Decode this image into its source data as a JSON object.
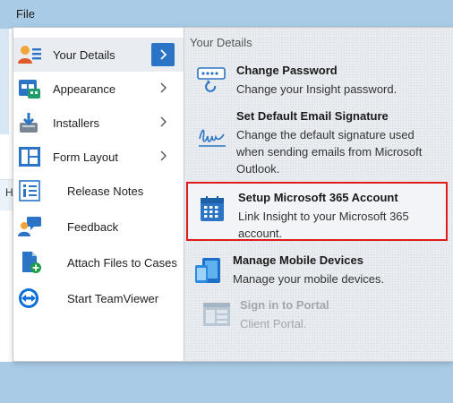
{
  "menubar": {
    "file_label": "File"
  },
  "background": {
    "tab_partial_letter": "H"
  },
  "menu": {
    "items": [
      {
        "label": "Your Details",
        "icon": "user-details-icon",
        "active": true,
        "has_submenu": true
      },
      {
        "label": "Appearance",
        "icon": "appearance-icon",
        "has_submenu": true
      },
      {
        "label": "Installers",
        "icon": "installers-icon",
        "has_submenu": true
      },
      {
        "label": "Form Layout",
        "icon": "form-layout-icon",
        "has_submenu": true
      },
      {
        "label": "Release Notes",
        "icon": "release-notes-icon",
        "has_submenu": false
      },
      {
        "label": "Feedback",
        "icon": "feedback-icon",
        "has_submenu": false
      },
      {
        "label": "Attach Files to Cases",
        "icon": "attach-files-icon",
        "has_submenu": false
      },
      {
        "label": "Start TeamViewer",
        "icon": "teamviewer-icon",
        "has_submenu": false
      }
    ],
    "submenu": {
      "title": "Your Details",
      "options": [
        {
          "title": "Change Password",
          "desc": "Change your Insight password.",
          "icon": "password-icon"
        },
        {
          "title": "Set Default Email Signature",
          "desc": "Change the default signature used when sending emails from Microsoft Outlook.",
          "icon": "signature-icon"
        },
        {
          "title": "Setup Microsoft 365 Account",
          "desc": "Link Insight to your Microsoft 365 account.",
          "icon": "calendar-icon",
          "highlighted": true
        },
        {
          "title": "Manage Mobile Devices",
          "desc": "Manage your mobile devices.",
          "icon": "mobile-devices-icon"
        },
        {
          "title": "Sign in to Portal",
          "desc": "Client Portal.",
          "icon": "portal-icon",
          "disabled": true
        }
      ]
    }
  },
  "colors": {
    "accent": "#2b74c6",
    "highlight_border": "#e01b1b",
    "menubar": "#a9cbe6"
  }
}
